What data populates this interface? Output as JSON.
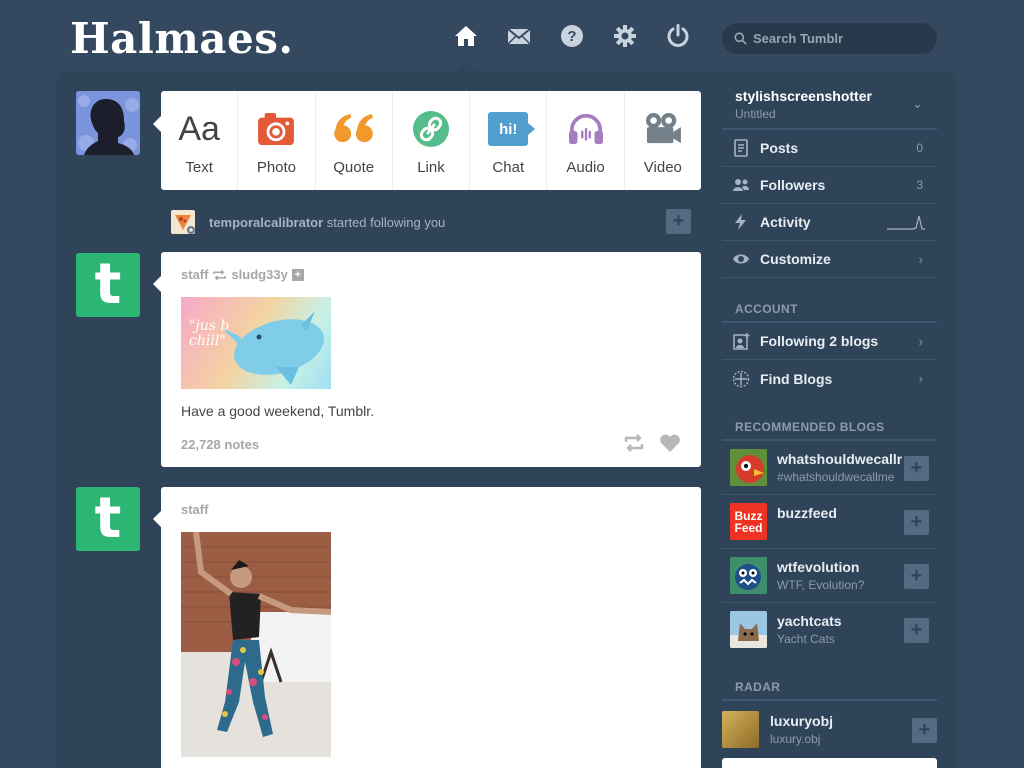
{
  "header": {
    "logo": "Halmaes.",
    "search_placeholder": "Search Tumblr",
    "nav": [
      {
        "name": "home-icon"
      },
      {
        "name": "mail-icon"
      },
      {
        "name": "help-icon"
      },
      {
        "name": "gear-icon"
      },
      {
        "name": "power-icon"
      }
    ]
  },
  "composer": {
    "types": [
      {
        "label": "Text",
        "icon": "Aa",
        "color": "#444444"
      },
      {
        "label": "Photo",
        "color": "#e4593a"
      },
      {
        "label": "Quote",
        "icon": "❝",
        "color": "#f2992e"
      },
      {
        "label": "Link",
        "color": "#56bc8a"
      },
      {
        "label": "Chat",
        "icon": "hi!",
        "color": "#529ecc"
      },
      {
        "label": "Audio",
        "color": "#a77dc2"
      },
      {
        "label": "Video",
        "color": "#748089"
      }
    ]
  },
  "notice": {
    "user": "temporalcalibrator",
    "text": "started following you"
  },
  "posts": [
    {
      "author": "staff",
      "reblogged_from": "sludg33y",
      "image_text": "\"jus b chill\"",
      "caption": "Have a good weekend, Tumblr.",
      "notes": "22,728 notes"
    },
    {
      "author": "staff"
    }
  ],
  "sidebar": {
    "blog_name": "stylishscreenshotter",
    "blog_title": "Untitled",
    "rows": [
      {
        "label": "Posts",
        "count": "0"
      },
      {
        "label": "Followers",
        "count": "3"
      },
      {
        "label": "Activity"
      },
      {
        "label": "Customize"
      }
    ],
    "account_heading": "ACCOUNT",
    "account_rows": [
      {
        "label": "Following 2 blogs"
      },
      {
        "label": "Find Blogs"
      }
    ],
    "recommended_heading": "RECOMMENDED BLOGS",
    "recommended": [
      {
        "name": "whatshouldwecallme",
        "sub": "#whatshouldwecallme"
      },
      {
        "name": "buzzfeed",
        "sub": "",
        "thumb_text": "Buzz Feed"
      },
      {
        "name": "wtfevolution",
        "sub": "WTF, Evolution?"
      },
      {
        "name": "yachtcats",
        "sub": "Yacht Cats"
      }
    ],
    "radar_heading": "RADAR",
    "radar": {
      "name": "luxuryobj",
      "sub": "luxury.obj"
    }
  }
}
